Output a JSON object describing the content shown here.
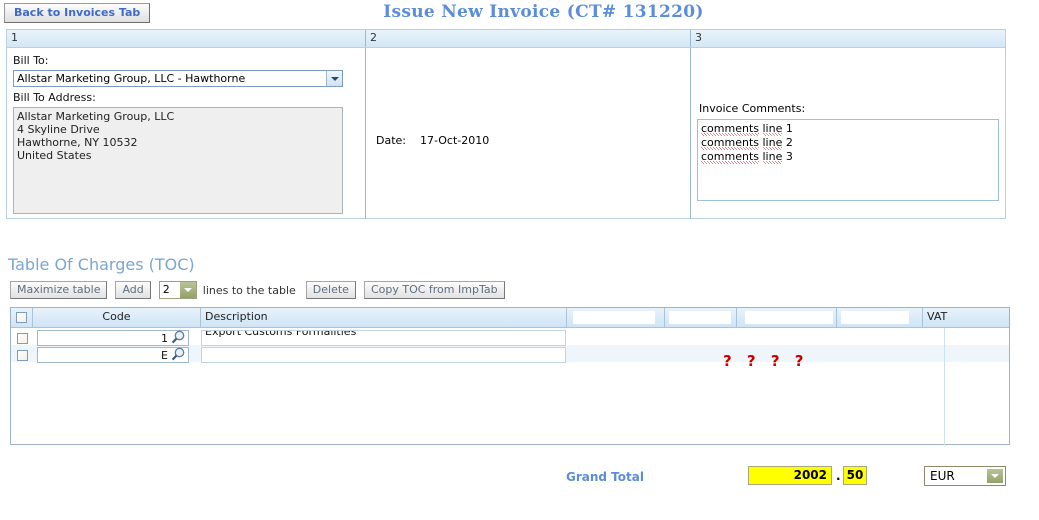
{
  "header": {
    "back_button": "Back to Invoices Tab",
    "title": "Issue New Invoice (CT# 131220)"
  },
  "panel": {
    "columns": [
      "1",
      "2",
      "3"
    ],
    "bill_to_label": "Bill To:",
    "bill_to_value": "Allstar Marketing Group, LLC - Hawthorne",
    "bill_to_address_label": "Bill To Address:",
    "bill_to_address": "Allstar Marketing Group, LLC\n4 Skyline Drive\nHawthorne, NY 10532\nUnited States",
    "date_label": "Date:",
    "date_value": "17-Oct-2010",
    "date_line": "Date:    17-Oct-2010",
    "comments_label": "Invoice Comments:",
    "comments": [
      "comments line 1",
      "comments line 2",
      "comments line 3"
    ],
    "comment_misspelled_words": [
      "comments",
      "line"
    ]
  },
  "toc": {
    "title": "Table Of Charges (TOC)",
    "maximize_button": "Maximize table",
    "add_button": "Add",
    "lines_count": "2",
    "lines_text": "lines to the table",
    "delete_button": "Delete",
    "copy_button": "Copy TOC from ImpTab",
    "grid": {
      "headers": [
        {
          "label": "",
          "name": "select-all",
          "redacted": false
        },
        {
          "label": "Code",
          "name": "code",
          "redacted": false
        },
        {
          "label": "Description",
          "name": "description",
          "redacted": false
        },
        {
          "label": "",
          "name": "column-4",
          "redacted": true
        },
        {
          "label": "",
          "name": "column-5",
          "redacted": true
        },
        {
          "label": "",
          "name": "column-6",
          "redacted": true
        },
        {
          "label": "",
          "name": "column-7",
          "redacted": true
        },
        {
          "label": "VAT",
          "name": "vat",
          "redacted": false
        }
      ],
      "rows": [
        {
          "checked": false,
          "code": "1",
          "description": "Export Customs Formalities"
        },
        {
          "checked": false,
          "code": "E",
          "description": "."
        }
      ],
      "annotation": "? ? ? ?"
    }
  },
  "footer": {
    "grand_total_label": "Grand Total",
    "grand_total_integer": "2002",
    "grand_total_separator": ".",
    "grand_total_decimal": "50",
    "currency": "EUR"
  },
  "colors": {
    "title_blue": "#5b8ddb",
    "heading_blue": "#7ba7cf",
    "annotation_red": "#cc0000",
    "total_highlight": "#ffff00",
    "panel_border": "#b9cfe2"
  }
}
